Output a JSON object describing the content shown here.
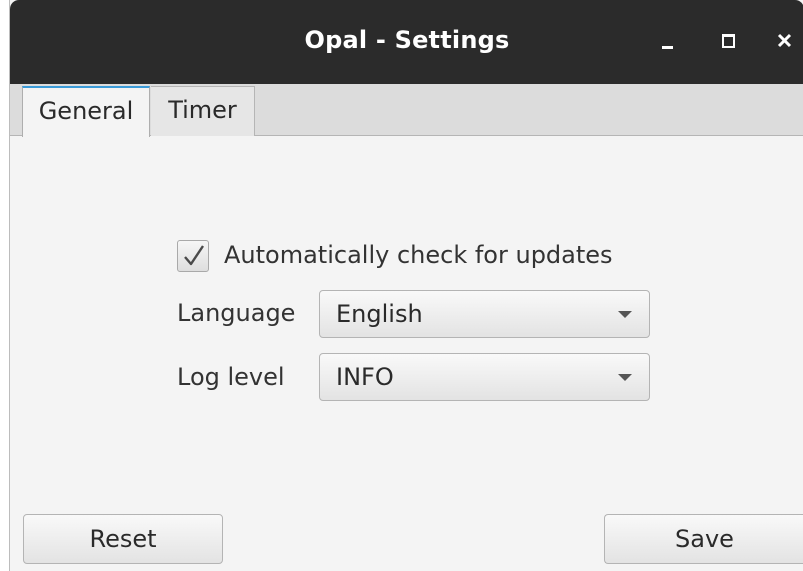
{
  "window": {
    "title": "Opal - Settings",
    "controls": [
      "minimize-icon",
      "maximize-icon",
      "close-icon"
    ]
  },
  "tabs": [
    {
      "label": "General",
      "active": true
    },
    {
      "label": "Timer",
      "active": false
    }
  ],
  "general": {
    "auto_update": {
      "label": "Automatically check for updates",
      "checked": true
    },
    "language": {
      "label": "Language",
      "value": "English"
    },
    "log_level": {
      "label": "Log level",
      "value": "INFO"
    }
  },
  "buttons": {
    "reset": "Reset",
    "save": "Save"
  },
  "colors": {
    "titlebar": "#2b2b2b",
    "tab_accent": "#3a9bd9",
    "background": "#f4f4f4"
  }
}
